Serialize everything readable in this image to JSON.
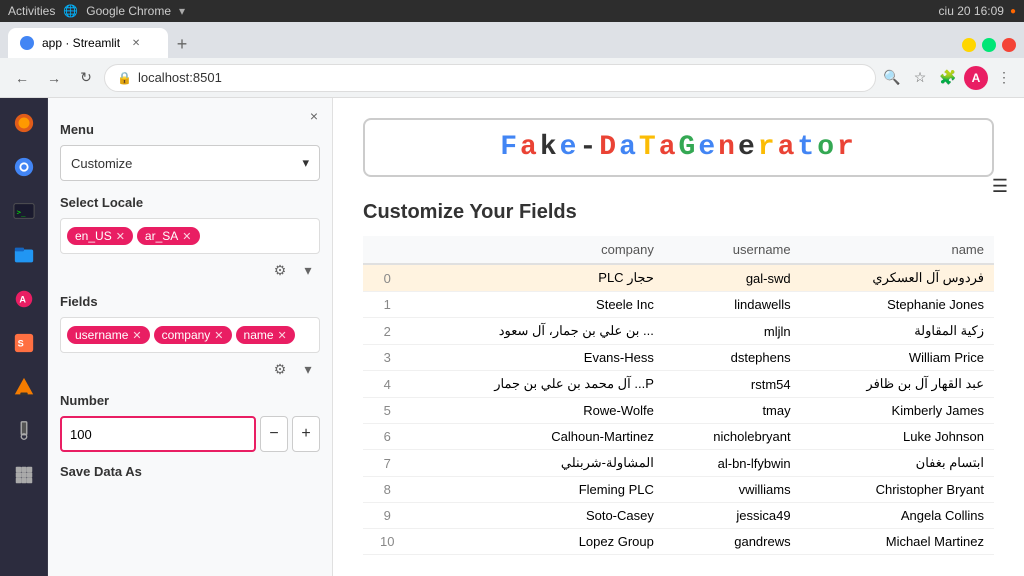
{
  "os": {
    "activities": "Activities",
    "browser_name": "Google Chrome",
    "time": "16:09",
    "day": "ciu 20"
  },
  "browser": {
    "tab_title": "app · Streamlit",
    "url": "localhost:8501",
    "new_tab_label": "+",
    "back_icon": "←",
    "forward_icon": "→",
    "refresh_icon": "↻",
    "profile_initial": "A",
    "menu_icon": "⋮"
  },
  "sidebar": {
    "close_icon": "×",
    "menu_label": "Menu",
    "menu_value": "Customize",
    "locale_label": "Select Locale",
    "locales": [
      {
        "id": "en_US",
        "label": "en_US"
      },
      {
        "id": "ar_SA",
        "label": "ar_SA"
      }
    ],
    "fields_label": "Fields",
    "fields": [
      {
        "id": "username",
        "label": "username"
      },
      {
        "id": "company",
        "label": "company"
      },
      {
        "id": "name",
        "label": "name"
      }
    ],
    "number_label": "Number",
    "number_value": "100",
    "minus_label": "−",
    "plus_label": "+",
    "save_data_label": "Save Data As"
  },
  "main": {
    "title_parts": [
      {
        "text": "F",
        "color": "#4285f4"
      },
      {
        "text": "a",
        "color": "#ea4335"
      },
      {
        "text": "k",
        "color": "#333"
      },
      {
        "text": "e",
        "color": "#4285f4"
      },
      {
        "text": "-",
        "color": "#333"
      },
      {
        "text": "D",
        "color": "#ea4335"
      },
      {
        "text": "a",
        "color": "#4285f4"
      },
      {
        "text": "T",
        "color": "#fbbc05"
      },
      {
        "text": "a",
        "color": "#ea4335"
      },
      {
        "text": "G",
        "color": "#34a853"
      },
      {
        "text": "e",
        "color": "#4285f4"
      },
      {
        "text": "n",
        "color": "#ea4335"
      },
      {
        "text": "e",
        "color": "#333"
      },
      {
        "text": "r",
        "color": "#fbbc05"
      },
      {
        "text": "a",
        "color": "#ea4335"
      },
      {
        "text": "t",
        "color": "#4285f4"
      },
      {
        "text": "o",
        "color": "#34a853"
      },
      {
        "text": "r",
        "color": "#ea4335"
      }
    ],
    "section_title": "Customize Your Fields",
    "table": {
      "columns": [
        "",
        "company",
        "username",
        "name"
      ],
      "rows": [
        {
          "idx": 0,
          "company": "حجار PLC",
          "username": "gal-swd",
          "name": "فردوس آل العسكري"
        },
        {
          "idx": 1,
          "company": "Steele Inc",
          "username": "lindawells",
          "name": "Stephanie Jones"
        },
        {
          "idx": 2,
          "company": "... بن علي بن جمار، آل سعود",
          "username": "mljln",
          "name": "زكية المقاولة"
        },
        {
          "idx": 3,
          "company": "Evans-Hess",
          "username": "dstephens",
          "name": "William Price"
        },
        {
          "idx": 4,
          "company": "P... آل محمد بن علي بن جمار",
          "username": "rstm54",
          "name": "عبد القهار آل بن ظافر"
        },
        {
          "idx": 5,
          "company": "Rowe-Wolfe",
          "username": "tmay",
          "name": "Kimberly James"
        },
        {
          "idx": 6,
          "company": "Calhoun-Martinez",
          "username": "nicholebryant",
          "name": "Luke Johnson"
        },
        {
          "idx": 7,
          "company": "المشاولة-شربنلي",
          "username": "al-bn-lfybwin",
          "name": "ابتسام بغفان"
        },
        {
          "idx": 8,
          "company": "Fleming PLC",
          "username": "vwilliams",
          "name": "Christopher Bryant"
        },
        {
          "idx": 9,
          "company": "Soto-Casey",
          "username": "jessica49",
          "name": "Angela Collins"
        },
        {
          "idx": 10,
          "company": "Lopez Group",
          "username": "gandrews",
          "name": "Michael Martinez"
        }
      ]
    }
  },
  "taskbar_icons": [
    "firefox",
    "chrome",
    "terminal",
    "files",
    "software",
    "sublime",
    "vlc",
    "usb",
    "apps"
  ]
}
